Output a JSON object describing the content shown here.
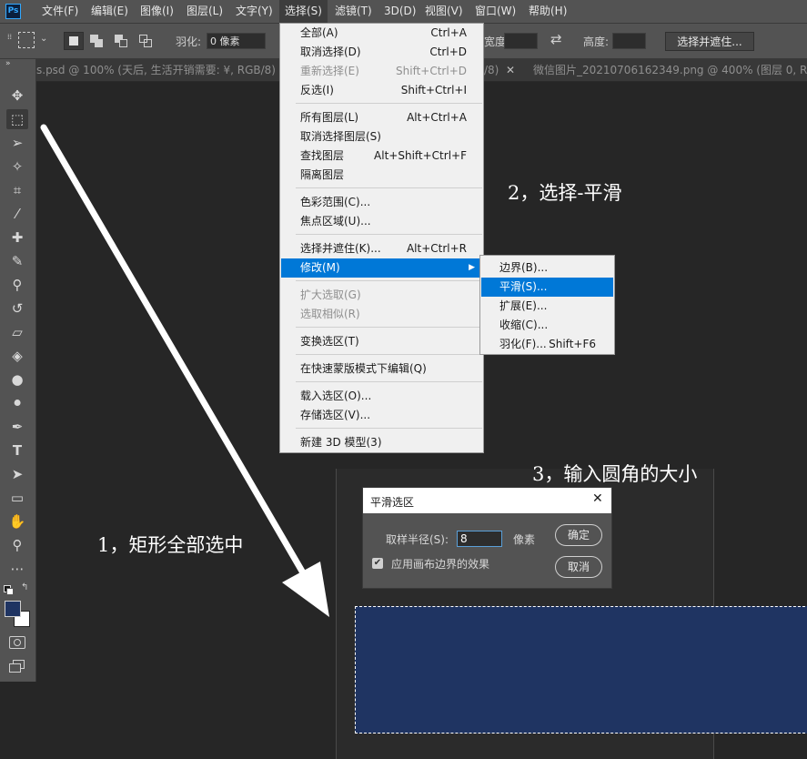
{
  "app": {
    "logo": "Ps"
  },
  "menubar": {
    "items": [
      {
        "label": "文件(F)"
      },
      {
        "label": "编辑(E)"
      },
      {
        "label": "图像(I)"
      },
      {
        "label": "图层(L)"
      },
      {
        "label": "文字(Y)"
      },
      {
        "label": "选择(S)"
      },
      {
        "label": "滤镜(T)"
      },
      {
        "label": "3D(D)"
      },
      {
        "label": "视图(V)"
      },
      {
        "label": "窗口(W)"
      },
      {
        "label": "帮助(H)"
      }
    ],
    "active_index": 5
  },
  "options_bar": {
    "feather_label": "羽化:",
    "feather_value": "0 像素",
    "width_label": "宽度:",
    "height_label": "高度:",
    "refine_edge_button": "选择并遮住..."
  },
  "tabs": [
    {
      "label": "s.psd @ 100% (天后, 生活开销需要: ¥, RGB/8) *"
    },
    {
      "label": "/8)"
    },
    {
      "label": "微信图片_20210706162349.png @ 400% (图层 0, RGB/"
    }
  ],
  "tools": [
    {
      "icon": "move-tool-icon",
      "glyph": "✥"
    },
    {
      "icon": "marquee-tool-icon",
      "glyph": "⬚"
    },
    {
      "icon": "lasso-tool-icon",
      "glyph": "➢"
    },
    {
      "icon": "magic-wand-tool-icon",
      "glyph": "✧"
    },
    {
      "icon": "crop-tool-icon",
      "glyph": "⌗"
    },
    {
      "icon": "eyedropper-tool-icon",
      "glyph": "⁄"
    },
    {
      "icon": "healing-brush-tool-icon",
      "glyph": "✚"
    },
    {
      "icon": "brush-tool-icon",
      "glyph": "✎"
    },
    {
      "icon": "clone-stamp-tool-icon",
      "glyph": "⚲"
    },
    {
      "icon": "history-brush-tool-icon",
      "glyph": "↺"
    },
    {
      "icon": "eraser-tool-icon",
      "glyph": "▱"
    },
    {
      "icon": "paint-bucket-tool-icon",
      "glyph": "◈"
    },
    {
      "icon": "blur-tool-icon",
      "glyph": "●"
    },
    {
      "icon": "dodge-tool-icon",
      "glyph": "⚫"
    },
    {
      "icon": "pen-tool-icon",
      "glyph": "✒"
    },
    {
      "icon": "type-tool-icon",
      "glyph": "T"
    },
    {
      "icon": "path-selection-tool-icon",
      "glyph": "➤"
    },
    {
      "icon": "rectangle-tool-icon",
      "glyph": "▭"
    },
    {
      "icon": "hand-tool-icon",
      "glyph": "✋"
    },
    {
      "icon": "zoom-tool-icon",
      "glyph": "⚲"
    },
    {
      "icon": "more-tools-icon",
      "glyph": "⋯"
    }
  ],
  "colors": {
    "foreground": "#1f3462",
    "background": "#ffffff",
    "highlight": "#0078d7",
    "canvas_fill": "#1f3462"
  },
  "select_menu": {
    "groups": [
      [
        {
          "label": "全部(A)",
          "shortcut": "Ctrl+A",
          "disabled": false
        },
        {
          "label": "取消选择(D)",
          "shortcut": "Ctrl+D",
          "disabled": false
        },
        {
          "label": "重新选择(E)",
          "shortcut": "Shift+Ctrl+D",
          "disabled": true
        },
        {
          "label": "反选(I)",
          "shortcut": "Shift+Ctrl+I",
          "disabled": false
        }
      ],
      [
        {
          "label": "所有图层(L)",
          "shortcut": "Alt+Ctrl+A",
          "disabled": false
        },
        {
          "label": "取消选择图层(S)",
          "shortcut": "",
          "disabled": false
        },
        {
          "label": "查找图层",
          "shortcut": "Alt+Shift+Ctrl+F",
          "disabled": false
        },
        {
          "label": "隔离图层",
          "shortcut": "",
          "disabled": false
        }
      ],
      [
        {
          "label": "色彩范围(C)...",
          "shortcut": "",
          "disabled": false
        },
        {
          "label": "焦点区域(U)...",
          "shortcut": "",
          "disabled": false
        }
      ],
      [
        {
          "label": "选择并遮住(K)...",
          "shortcut": "Alt+Ctrl+R",
          "disabled": false
        },
        {
          "label": "修改(M)",
          "shortcut": "",
          "disabled": false,
          "highlight": true,
          "submenu": true
        }
      ],
      [
        {
          "label": "扩大选取(G)",
          "shortcut": "",
          "disabled": true
        },
        {
          "label": "选取相似(R)",
          "shortcut": "",
          "disabled": true
        }
      ],
      [
        {
          "label": "变换选区(T)",
          "shortcut": "",
          "disabled": false
        }
      ],
      [
        {
          "label": "在快速蒙版模式下编辑(Q)",
          "shortcut": "",
          "disabled": false
        }
      ],
      [
        {
          "label": "载入选区(O)...",
          "shortcut": "",
          "disabled": false
        },
        {
          "label": "存储选区(V)...",
          "shortcut": "",
          "disabled": false
        }
      ],
      [
        {
          "label": "新建 3D 模型(3)",
          "shortcut": "",
          "disabled": false
        }
      ]
    ]
  },
  "modify_submenu": {
    "items": [
      {
        "label": "边界(B)...",
        "shortcut": ""
      },
      {
        "label": "平滑(S)...",
        "shortcut": "",
        "highlight": true
      },
      {
        "label": "扩展(E)...",
        "shortcut": ""
      },
      {
        "label": "收缩(C)...",
        "shortcut": ""
      },
      {
        "label": "羽化(F)...",
        "shortcut": "Shift+F6"
      }
    ]
  },
  "smooth_dialog": {
    "title": "平滑选区",
    "close_glyph": "✕",
    "radius_label": "取样半径(S):",
    "radius_value": "8",
    "unit": "像素",
    "apply_canvas_label": "应用画布边界的效果",
    "apply_canvas_checked": true,
    "ok_button": "确定",
    "cancel_button": "取消"
  },
  "annotations": {
    "step1": "1，矩形全部选中",
    "step2": "2，选择-平滑",
    "step3": "3，输入圆角的大小"
  }
}
